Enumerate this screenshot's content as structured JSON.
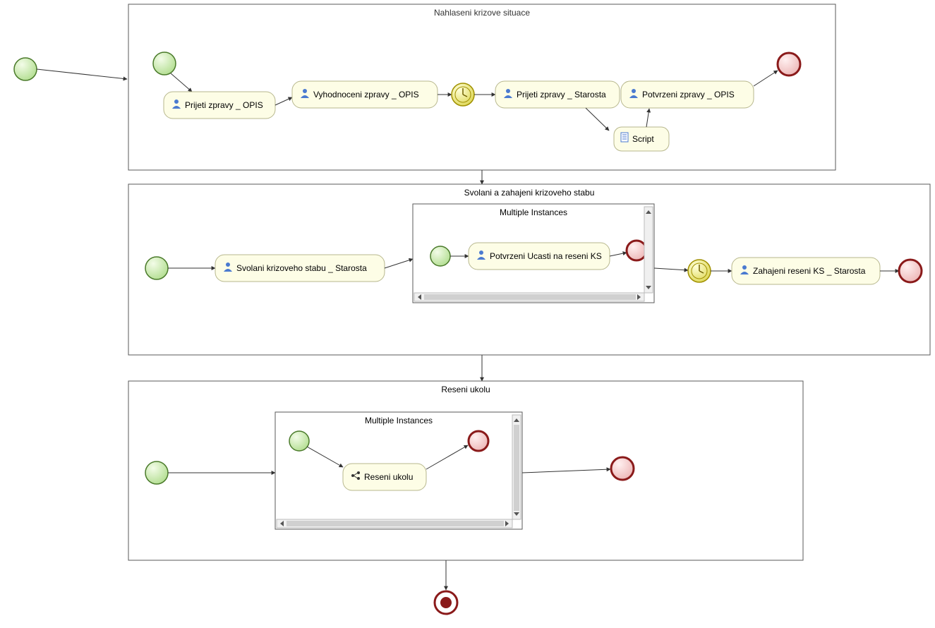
{
  "pools": {
    "p1": {
      "title": "Nahlaseni krizove situace"
    },
    "p2": {
      "title": "Svolani a zahajeni krizoveho stabu"
    },
    "p3": {
      "title": "Reseni ukolu"
    }
  },
  "subprocesses": {
    "sp1": {
      "title": "Multiple Instances"
    },
    "sp2": {
      "title": "Multiple Instances"
    }
  },
  "tasks": {
    "t1": "Prijeti zpravy _ OPIS",
    "t2": "Vyhodnoceni zpravy _ OPIS",
    "t3": "Prijeti zpravy _ Starosta",
    "t4": "Potvrzeni zpravy _ OPIS",
    "t5": "Script",
    "t6": "Svolani krizoveho stabu _ Starosta",
    "t7": "Potvrzeni Ucasti na reseni KS",
    "t8": "Zahajeni reseni KS _ Starosta",
    "t9": "Reseni ukolu"
  },
  "colors": {
    "pool_fill": "#ffffff",
    "pool_stroke": "#5a5a5a",
    "task_fill": "#fdfde6",
    "task_stroke": "#b7b78d",
    "start_fill": "#d8f0c8",
    "start_stroke": "#4a7a2a",
    "end_fill": "#f6d0d0",
    "end_stroke": "#8a1a1a",
    "timer_fill": "#f5f07a",
    "timer_stroke": "#a09000"
  }
}
